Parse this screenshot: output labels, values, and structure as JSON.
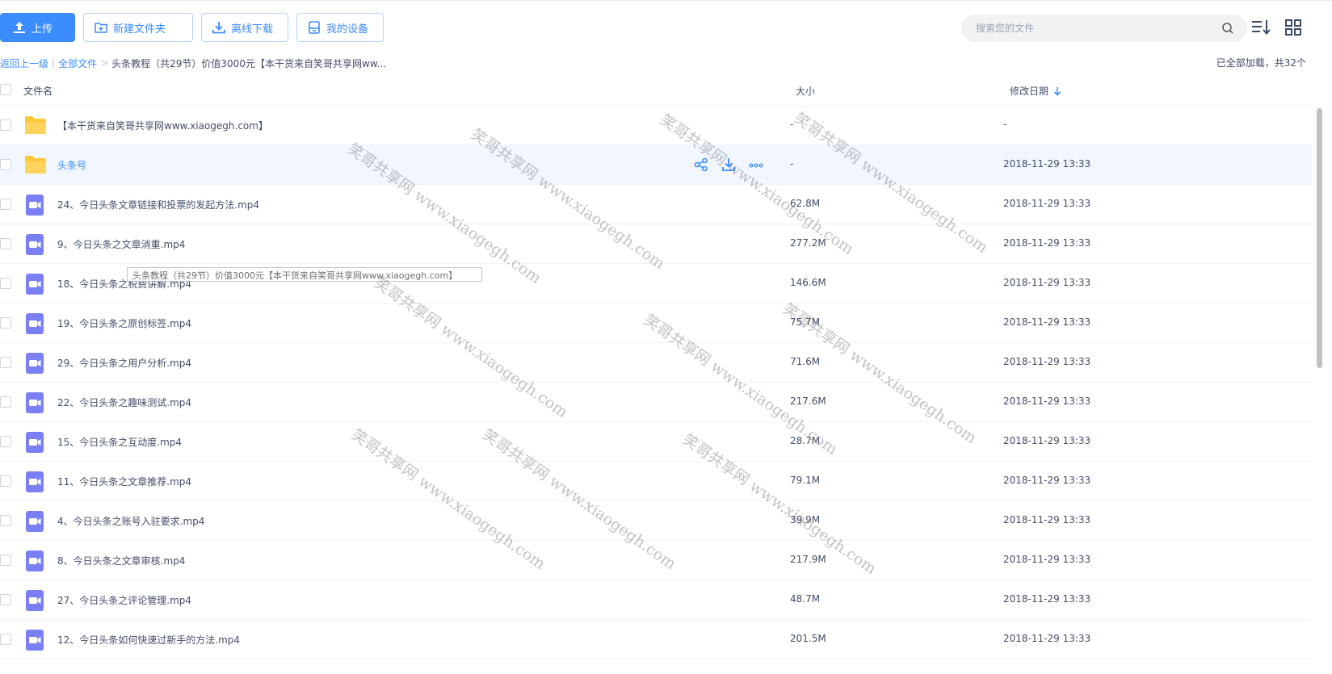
{
  "toolbar": {
    "upload_label": "上传",
    "new_folder_label": "新建文件夹",
    "offline_download_label": "离线下载",
    "my_devices_label": "我的设备"
  },
  "search": {
    "placeholder": "搜索您的文件"
  },
  "breadcrumb": {
    "back": "返回上一级",
    "divider": "|",
    "all_files": "全部文件",
    "separator": ">",
    "current": "头条教程（共29节）价值3000元【本干货来自笑哥共享网ww..."
  },
  "load_status": "已全部加载，共32个",
  "table": {
    "col_name": "文件名",
    "col_size": "大小",
    "col_date": "修改日期",
    "rows": [
      {
        "type": "folder",
        "name": "【本干货来自笑哥共享网www.xiaogegh.com】",
        "size": "-",
        "date": "-"
      },
      {
        "type": "folder",
        "name": "头条号",
        "size": "-",
        "date": "2018-11-29 13:33"
      },
      {
        "type": "video",
        "name": "24、今日头条文章链接和投票的发起方法.mp4",
        "size": "62.8M",
        "date": "2018-11-29 13:33"
      },
      {
        "type": "video",
        "name": "9、今日头条之文章消重.mp4",
        "size": "277.2M",
        "date": "2018-11-29 13:33"
      },
      {
        "type": "video",
        "name": "18、今日头条之税费讲解.mp4",
        "size": "146.6M",
        "date": "2018-11-29 13:33"
      },
      {
        "type": "video",
        "name": "19、今日头条之原创标签.mp4",
        "size": "75.7M",
        "date": "2018-11-29 13:33"
      },
      {
        "type": "video",
        "name": "29、今日头条之用户分析.mp4",
        "size": "71.6M",
        "date": "2018-11-29 13:33"
      },
      {
        "type": "video",
        "name": "22、今日头条之趣味测试.mp4",
        "size": "217.6M",
        "date": "2018-11-29 13:33"
      },
      {
        "type": "video",
        "name": "15、今日头条之互动度.mp4",
        "size": "28.7M",
        "date": "2018-11-29 13:33"
      },
      {
        "type": "video",
        "name": "11、今日头条之文章推荐.mp4",
        "size": "79.1M",
        "date": "2018-11-29 13:33"
      },
      {
        "type": "video",
        "name": "4、今日头条之账号入驻要求.mp4",
        "size": "39.9M",
        "date": "2018-11-29 13:33"
      },
      {
        "type": "video",
        "name": "8、今日头条之文章审核.mp4",
        "size": "217.9M",
        "date": "2018-11-29 13:33"
      },
      {
        "type": "video",
        "name": "27、今日头条之评论管理.mp4",
        "size": "48.7M",
        "date": "2018-11-29 13:33"
      },
      {
        "type": "video",
        "name": "12、今日头条如何快速过新手的方法.mp4",
        "size": "201.5M",
        "date": "2018-11-29 13:33"
      }
    ]
  },
  "tooltip": "头条教程（共29节）价值3000元【本干货来自笑哥共享网www.xiaogegh.com】",
  "watermark": "笑哥共享网 www.xiaogegh.com",
  "icons": {
    "upload": "upload-icon",
    "new_folder": "new-folder-icon",
    "download": "download-icon",
    "device": "device-icon",
    "search": "search-icon",
    "sort": "sort-icon",
    "grid": "grid-view-icon",
    "share": "share-icon",
    "more": "more-icon",
    "folder": "folder-icon",
    "video": "video-file-icon"
  },
  "colors": {
    "accent": "#3b8cff",
    "folder": "#ffc73a",
    "video": "#7b7ff4",
    "hover_row": "#f1f6ff"
  }
}
